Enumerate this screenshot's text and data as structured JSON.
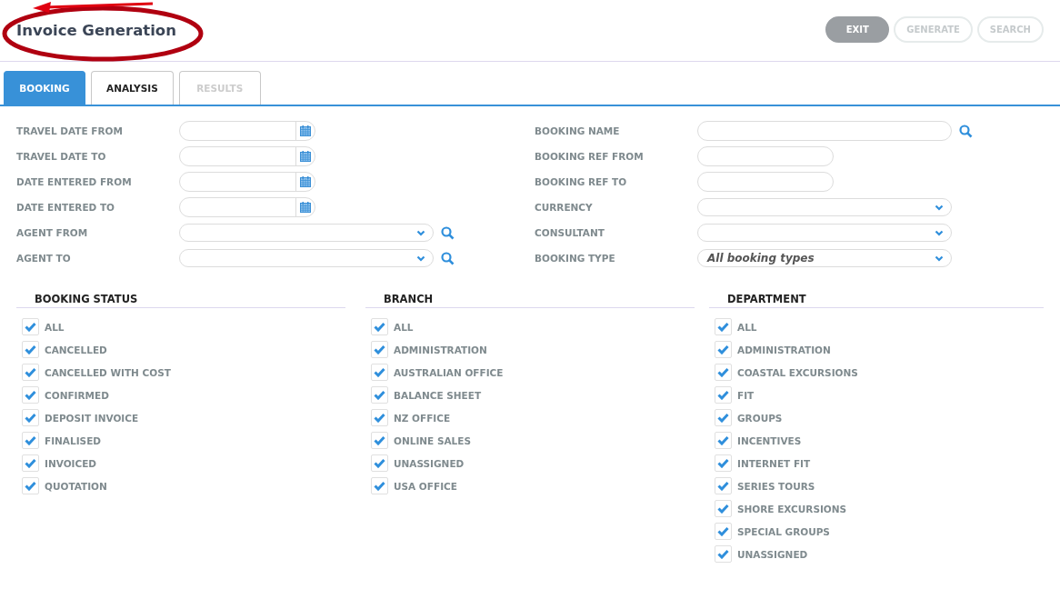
{
  "header": {
    "title": "Invoice Generation",
    "annotation": true
  },
  "buttons": [
    {
      "label": "EXIT",
      "disabled": false
    },
    {
      "label": "GENERATE",
      "disabled": true
    },
    {
      "label": "SEARCH",
      "disabled": true
    }
  ],
  "tabs": [
    {
      "label": "BOOKING",
      "selected": true,
      "disabled": false
    },
    {
      "label": "ANALYSIS",
      "selected": false,
      "disabled": false
    },
    {
      "label": "RESULTS",
      "selected": false,
      "disabled": true
    }
  ],
  "form_left": [
    {
      "label": "TRAVEL DATE FROM",
      "kind": "date"
    },
    {
      "label": "TRAVEL DATE TO",
      "kind": "date"
    },
    {
      "label": "DATE ENTERED FROM",
      "kind": "date"
    },
    {
      "label": "DATE ENTERED TO",
      "kind": "date"
    },
    {
      "label": "AGENT FROM",
      "kind": "select",
      "search": true
    },
    {
      "label": "AGENT TO",
      "kind": "select",
      "search": true
    }
  ],
  "form_right": [
    {
      "label": "BOOKING NAME",
      "kind": "text",
      "wide": true,
      "search": true
    },
    {
      "label": "BOOKING REF FROM",
      "kind": "text",
      "wide": false,
      "search": false
    },
    {
      "label": "BOOKING REF TO",
      "kind": "text",
      "wide": false,
      "search": false
    },
    {
      "label": "CURRENCY",
      "kind": "select",
      "search": false
    },
    {
      "label": "CONSULTANT",
      "kind": "select",
      "search": false
    },
    {
      "label": "BOOKING TYPE",
      "kind": "select",
      "search": false,
      "value": "All booking types"
    }
  ],
  "groups": [
    {
      "title": "BOOKING STATUS",
      "items": [
        {
          "label": "ALL",
          "checked": true
        },
        {
          "label": "CANCELLED",
          "checked": true
        },
        {
          "label": "CANCELLED WITH COST",
          "checked": true
        },
        {
          "label": "CONFIRMED",
          "checked": true
        },
        {
          "label": "DEPOSIT INVOICE",
          "checked": true
        },
        {
          "label": "FINALISED",
          "checked": true
        },
        {
          "label": "INVOICED",
          "checked": true
        },
        {
          "label": "QUOTATION",
          "checked": true
        }
      ]
    },
    {
      "title": "BRANCH",
      "items": [
        {
          "label": "ALL",
          "checked": true
        },
        {
          "label": "ADMINISTRATION",
          "checked": true
        },
        {
          "label": "AUSTRALIAN OFFICE",
          "checked": true
        },
        {
          "label": "BALANCE SHEET",
          "checked": true
        },
        {
          "label": "NZ OFFICE",
          "checked": true
        },
        {
          "label": "ONLINE SALES",
          "checked": true
        },
        {
          "label": "UNASSIGNED",
          "checked": true
        },
        {
          "label": "USA OFFICE",
          "checked": true
        }
      ]
    },
    {
      "title": "DEPARTMENT",
      "items": [
        {
          "label": "ALL",
          "checked": true
        },
        {
          "label": "ADMINISTRATION",
          "checked": true
        },
        {
          "label": "COASTAL EXCURSIONS",
          "checked": true
        },
        {
          "label": "FIT",
          "checked": true
        },
        {
          "label": "GROUPS",
          "checked": true
        },
        {
          "label": "INCENTIVES",
          "checked": true
        },
        {
          "label": "INTERNET FIT",
          "checked": true
        },
        {
          "label": "SERIES TOURS",
          "checked": true
        },
        {
          "label": "SHORE EXCURSIONS",
          "checked": true
        },
        {
          "label": "SPECIAL GROUPS",
          "checked": true
        },
        {
          "label": "UNASSIGNED",
          "checked": true
        }
      ]
    }
  ]
}
